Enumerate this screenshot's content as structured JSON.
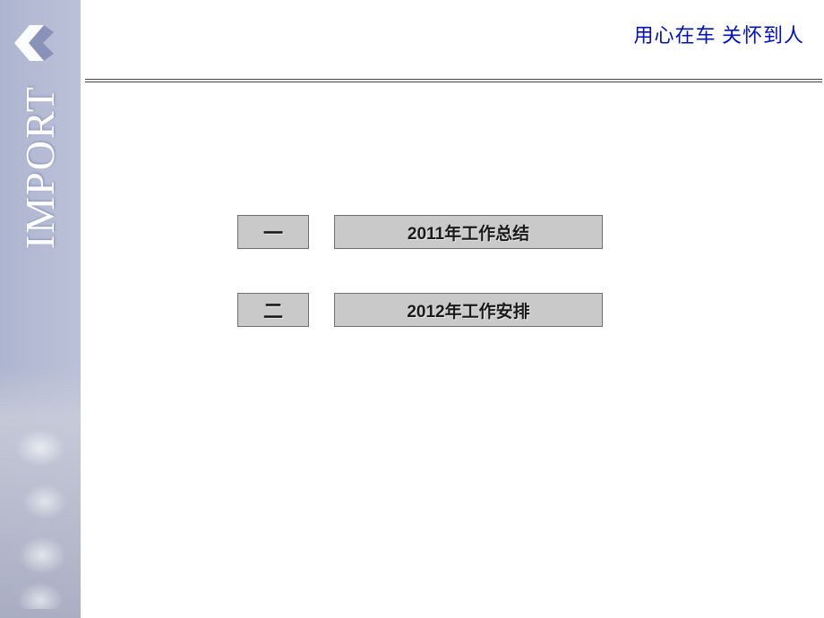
{
  "slogan": "用心在车 关怀到人",
  "sidebarText": "IMPORT",
  "items": [
    {
      "num": "一",
      "label": "2011年工作总结"
    },
    {
      "num": "二",
      "label": "2012年工作安排"
    }
  ]
}
